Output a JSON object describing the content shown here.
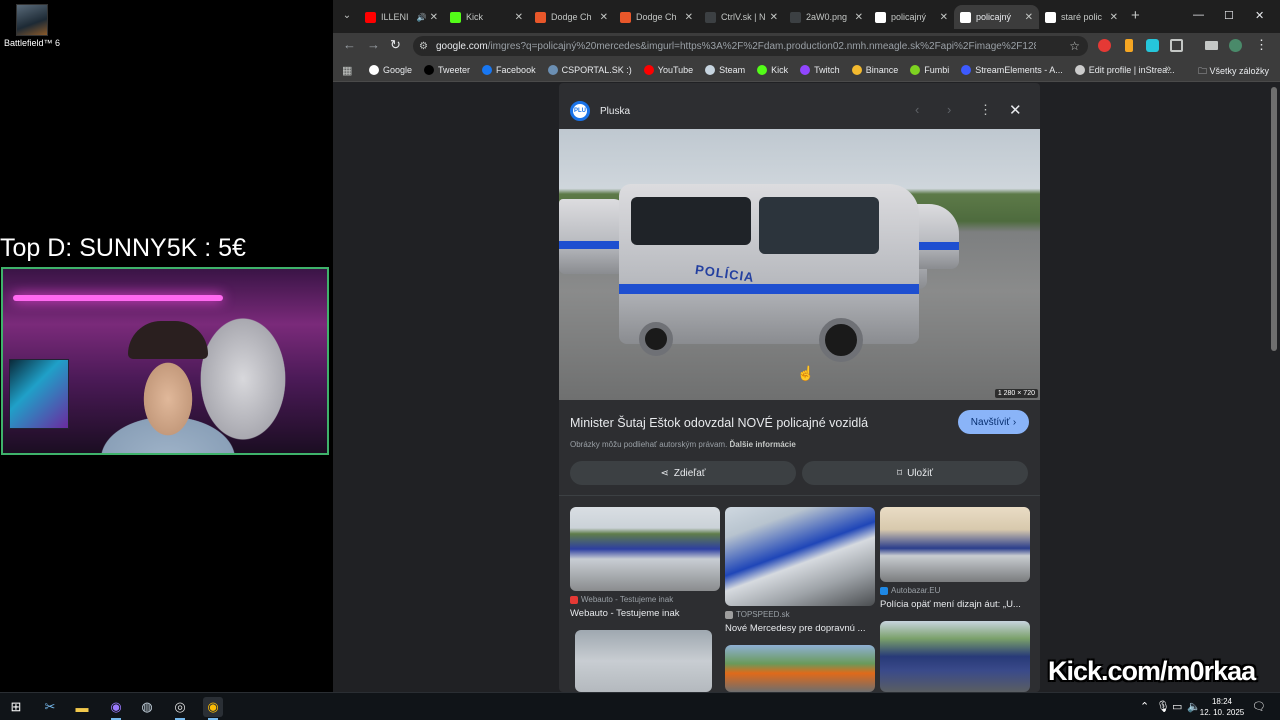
{
  "desktop": {
    "icon_label": "Battlefield™ 6",
    "top_donor": "Top D: SUNNY5K : 5€",
    "watermark": "Kick.com/m0rkaa"
  },
  "browser": {
    "tab_menu_icon": "chevron-down-icon",
    "tabs": [
      {
        "label": "ILLENI",
        "favicon_color": "#ff0000",
        "icon": "youtube-icon"
      },
      {
        "label": "Kick",
        "favicon_color": "#53fc18",
        "icon": "kick-icon"
      },
      {
        "label": "Dodge Ch",
        "favicon_color": "#e8572a",
        "icon": "chat-icon"
      },
      {
        "label": "Dodge Ch",
        "favicon_color": "#e8572a",
        "icon": "chat-icon"
      },
      {
        "label": "CtrlV.sk | N",
        "favicon_color": "#3c4043",
        "icon": "ctrlv-icon"
      },
      {
        "label": "2aW0.png",
        "favicon_color": "#3c4043",
        "icon": "ctrlv-icon"
      },
      {
        "label": "policajný",
        "favicon_color": "#ffffff",
        "icon": "google-icon"
      },
      {
        "label": "policajný",
        "favicon_color": "#ffffff",
        "icon": "google-icon"
      },
      {
        "label": "staré polic",
        "favicon_color": "#ffffff",
        "icon": "google-icon"
      }
    ],
    "url_host": "google.com",
    "url_path": "/imgres?q=policajný%20mercedes&imgurl=https%3A%2F%2Fdam.production02.nmh.nmeagle.sk%2Fapi%2Fimage%2F1280x720%2F4...",
    "bookmarks": [
      {
        "label": "Google",
        "color": "#ffffff"
      },
      {
        "label": "Tweeter",
        "color": "#000000"
      },
      {
        "label": "Facebook",
        "color": "#1877f2"
      },
      {
        "label": "CSPORTAL.SK :)",
        "color": "#6b8fb3"
      },
      {
        "label": "YouTube",
        "color": "#ff0000"
      },
      {
        "label": "Steam",
        "color": "#c7d5e0"
      },
      {
        "label": "Kick",
        "color": "#53fc18"
      },
      {
        "label": "Twitch",
        "color": "#9146ff"
      },
      {
        "label": "Binance",
        "color": "#f3ba2f"
      },
      {
        "label": "Fumbi",
        "color": "#7ed321"
      },
      {
        "label": "StreamElements - A...",
        "color": "#3d5afe"
      },
      {
        "label": "Edit profile | inStrea...",
        "color": "#cccccc"
      }
    ],
    "bookmark_folder": "Všetky záložky"
  },
  "panel": {
    "source_name": "Pluska",
    "source_logo_text": "PLU",
    "image_label": "POLÍCIA",
    "resolution": "1 280 × 720",
    "title": "Minister Šutaj Eštok odovzdal NOVÉ policajné vozidlá",
    "visit_label": "Navštíviť",
    "copyright_text": "Obrázky môžu podliehať autorským právam.",
    "copyright_link": "Ďalšie informácie",
    "share_label": "Zdieľať",
    "save_label": "Uložiť",
    "related": [
      {
        "source": "Webauto - Testujeme inak",
        "title": "Webauto - Testujeme inak",
        "fav_color": "#e53935"
      },
      {
        "source": "TOPSPEED.sk",
        "title": "Nové Mercedesy pre dopravnú ...",
        "fav_color": "#9e9e9e"
      },
      {
        "source": "Autobazar.EU",
        "title": "Polícia opäť mení dizajn áut: „U...",
        "fav_color": "#1e88e5"
      }
    ]
  },
  "taskbar": {
    "time": "18:24",
    "date": "12. 10. 2025"
  }
}
